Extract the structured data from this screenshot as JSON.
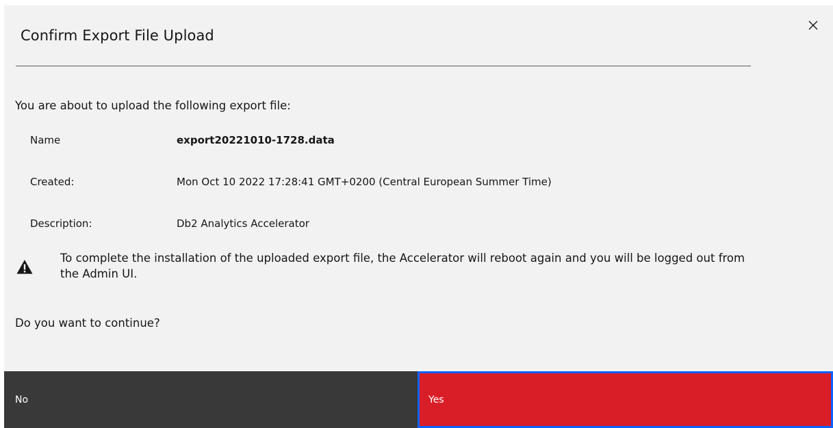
{
  "dialog": {
    "title": "Confirm Export File Upload",
    "intro": "You are about to upload the following export file:",
    "details": {
      "name_label": "Name",
      "name_value": "export20221010-1728.data",
      "created_label": "Created:",
      "created_value": "Mon Oct 10 2022 17:28:41 GMT+0200 (Central European Summer Time)",
      "description_label": "Description:",
      "description_value": "Db2 Analytics Accelerator"
    },
    "warning": "To complete the installation of the uploaded export file, the Accelerator will reboot again and you will be logged out from the Admin UI.",
    "question": "Do you want to continue?",
    "buttons": {
      "no_label": "No",
      "yes_label": "Yes"
    },
    "icons": {
      "close": "close-icon",
      "warning": "warning-icon"
    },
    "colors": {
      "background": "#f2f2f2",
      "no_button": "#393939",
      "yes_button": "#da1e28",
      "focus": "#0f62fe"
    }
  }
}
